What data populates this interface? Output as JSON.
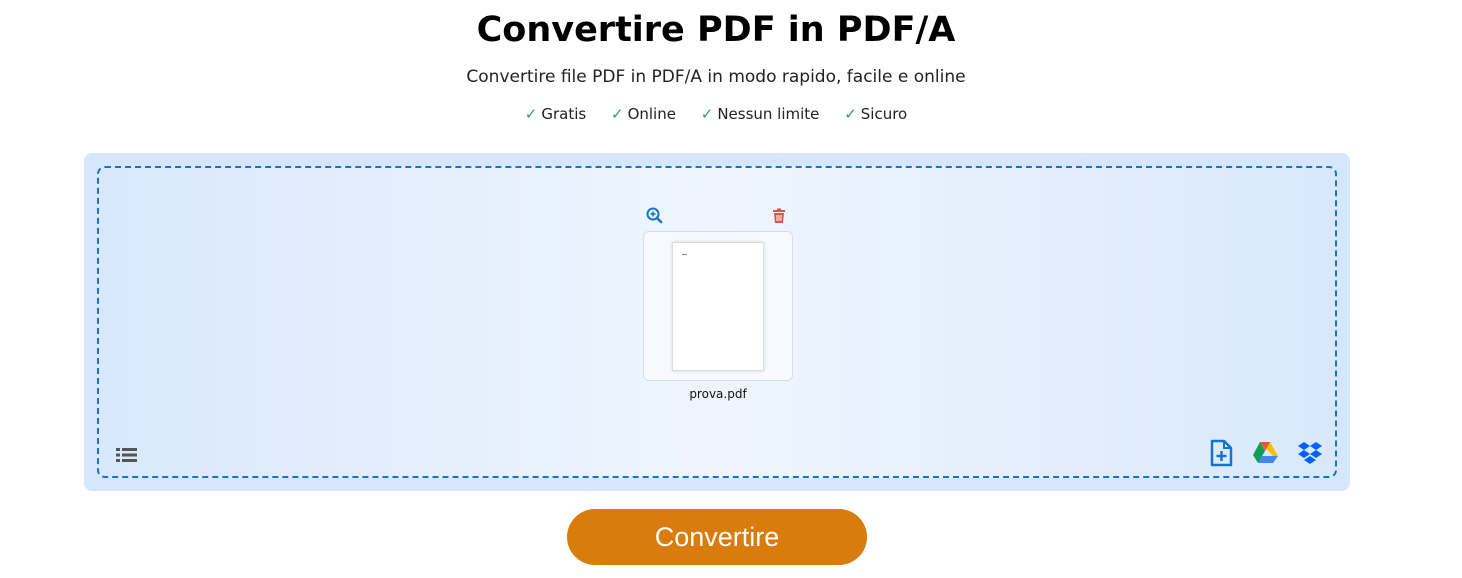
{
  "header": {
    "title": "Convertire PDF in PDF/A",
    "subtitle": "Convertire file PDF in PDF/A in modo rapido, facile e online"
  },
  "features": [
    {
      "check": "✓",
      "label": "Gratis"
    },
    {
      "check": "✓",
      "label": "Online"
    },
    {
      "check": "✓",
      "label": "Nessun limite"
    },
    {
      "check": "✓",
      "label": "Sicuro"
    }
  ],
  "upload": {
    "file": {
      "name": "prova.pdf",
      "zoom_icon": "zoom-in-icon",
      "delete_icon": "trash-icon"
    },
    "list_icon": "list-icon",
    "sources": {
      "add_file_icon": "add-file-icon",
      "google_drive_icon": "google-drive-icon",
      "dropbox_icon": "dropbox-icon"
    }
  },
  "action": {
    "convert_label": "Convertire"
  },
  "colors": {
    "accent": "#d97c0c",
    "check": "#2aa36b",
    "dropzone_border": "#1576c9",
    "dropzone_bg": "#d6e7fd",
    "delete": "#d9534f",
    "icon_blue": "#1576c9"
  }
}
